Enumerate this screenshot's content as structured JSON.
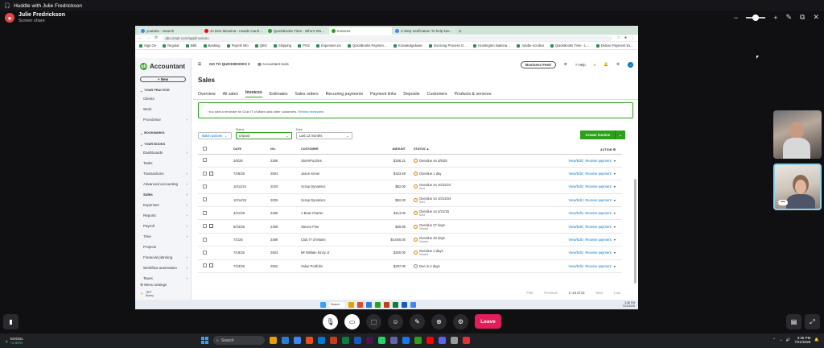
{
  "huddle": {
    "title": "Huddle with Julie Fredrickson",
    "presenter_name": "Julie Fredrickson",
    "presenter_status": "Screen share",
    "leave_label": "Leave"
  },
  "browser": {
    "tabs": [
      {
        "label": "youtube - Search",
        "color": "#4285f4"
      },
      {
        "label": "Jo Dee Messina - Heads Carol…",
        "color": "#ff0000"
      },
      {
        "label": "QuickBooks Time - Who's Wo…",
        "color": "#2ca01c"
      },
      {
        "label": "Invoices",
        "color": "#2ca01c"
      },
      {
        "label": "2-Step Verification To help kee…",
        "color": "#4285f4"
      }
    ],
    "url": "qbo.intuit.com/app/invoices",
    "bookmarks": [
      "Sign On",
      "Regular",
      "Bills",
      "Banking",
      "Payroll Info",
      "QBO",
      "Shipping",
      "POS",
      "Expenses.inv",
      "QuickBooks Paymen…",
      "Knowledgebase",
      "Invoicing Process O…",
      "Huntington Nationa…",
      "Adobe Acrobat",
      "QuickBooks Time - L…",
      "Deluxe Payment Ex…"
    ]
  },
  "sidebar": {
    "product": "Accountant",
    "new_label": "+ New",
    "sections": [
      {
        "label": "YOUR PRACTICE",
        "items": [
          {
            "label": "Clients"
          },
          {
            "label": "Work"
          },
          {
            "label": "ProAdvisor",
            "caret": "›"
          }
        ]
      },
      {
        "label": "BOOKMARKS",
        "items": []
      },
      {
        "label": "YOUR BOOKS",
        "items": [
          {
            "label": "Dashboards",
            "caret": "›"
          },
          {
            "label": "Tasks"
          },
          {
            "label": "Transactions",
            "caret": "›"
          },
          {
            "label": "Advanced accounting",
            "caret": "›"
          },
          {
            "label": "Sales",
            "caret": "›",
            "bold": true
          },
          {
            "label": "Expenses",
            "caret": "›"
          },
          {
            "label": "Reports",
            "caret": "›"
          },
          {
            "label": "Payroll",
            "caret": "›"
          },
          {
            "label": "Time",
            "caret": "›"
          },
          {
            "label": "Projects"
          },
          {
            "label": "Financial planning",
            "caret": "›"
          },
          {
            "label": "Workflow automation",
            "caret": "›"
          },
          {
            "label": "Taxes",
            "caret": "›"
          }
        ]
      }
    ],
    "menu_settings": "Menu settings",
    "weather": "78°F",
    "weather_sub": "Sunny"
  },
  "topbar": {
    "goto": "GO TO QUICKBOOKS",
    "tools": "Accountant tools",
    "feedback": "Business Feed",
    "help": "Help"
  },
  "page": {
    "title": "Sales",
    "tabs": [
      "Overview",
      "All sales",
      "Invoices",
      "Estimates",
      "Sales orders",
      "Recurring payments",
      "Payment links",
      "Deposits",
      "Customers",
      "Products & services"
    ],
    "active_tab": "Invoices",
    "reminder_text": "You sent a reminder for Club IT of Miami and other customers.",
    "reminder_link": "Review reminders"
  },
  "filters": {
    "batch": "Batch actions",
    "status_label": "Status",
    "status_value": "Unpaid",
    "date_label": "Date",
    "date_value": "Last 12 months",
    "create": "Create invoice"
  },
  "table": {
    "headers": {
      "date": "DATE",
      "no": "NO.",
      "customer": "CUSTOMER",
      "amount": "AMOUNT",
      "status": "STATUS ▲",
      "action": "ACTION"
    },
    "rows": [
      {
        "date": "3/6/25",
        "no": "2269",
        "customer": "StormPuzzles",
        "amount": "$258.21",
        "status": "Overdue on 3/6/25",
        "sub": "",
        "attach": false
      },
      {
        "date": "7/28/25",
        "no": "2504",
        "customer": "Jason Kriner",
        "amount": "$323.59",
        "status": "Overdue 1 day",
        "sub": "",
        "attach": true
      },
      {
        "date": "10/11/24",
        "no": "2020",
        "customer": "Scrap Dynamics",
        "amount": "$82.00",
        "status": "Overdue on 10/11/24",
        "sub": "Sent",
        "attach": false
      },
      {
        "date": "10/14/24",
        "no": "2025",
        "customer": "Scrap Dynamics",
        "amount": "$82.00",
        "status": "Overdue on 10/14/24",
        "sub": "Sent",
        "attach": false
      },
      {
        "date": "3/21/25",
        "no": "2280",
        "customer": "A Boat Charter",
        "amount": "$114.00",
        "status": "Overdue on 3/21/25",
        "sub": "Sent",
        "attach": false
      },
      {
        "date": "6/24/25",
        "no": "2459",
        "customer": "Steven Fine",
        "amount": "$39.95",
        "status": "Overdue 27 days",
        "sub": "Viewed",
        "attach": true
      },
      {
        "date": "7/1/25",
        "no": "2489",
        "customer": "Club IT of Miami",
        "amount": "$4,000.00",
        "status": "Overdue 20 days",
        "sub": "Viewed",
        "attach": false
      },
      {
        "date": "7/18/25",
        "no": "2503",
        "customer": "Mr William Kinzy Jr",
        "amount": "$300.00",
        "status": "Overdue 3 days",
        "sub": "Viewed",
        "attach": false
      },
      {
        "date": "7/23/25",
        "no": "2502",
        "customer": "Value Portfolio",
        "amount": "$297.00",
        "status": "Due in 2 days",
        "sub": "",
        "attach": true
      }
    ],
    "action_view": "View/Edit",
    "action_receive": "Receive payment"
  },
  "pager": {
    "first": "First",
    "prev": "Previous",
    "range": "1–13 of 13",
    "next": "Next",
    "last": "Last"
  },
  "inner_taskbar": {
    "search": "Search",
    "time": "3:38 PM",
    "date": "7/21/2025"
  },
  "taskbar": {
    "stock_name": "GOOGL",
    "stock_change": "+2.60%",
    "search": "Search",
    "time": "3:38 PM",
    "date": "7/21/2025"
  },
  "colors": {
    "qb_green": "#2ca01c",
    "link_blue": "#0077c5",
    "leave_red": "#e01e5a"
  }
}
